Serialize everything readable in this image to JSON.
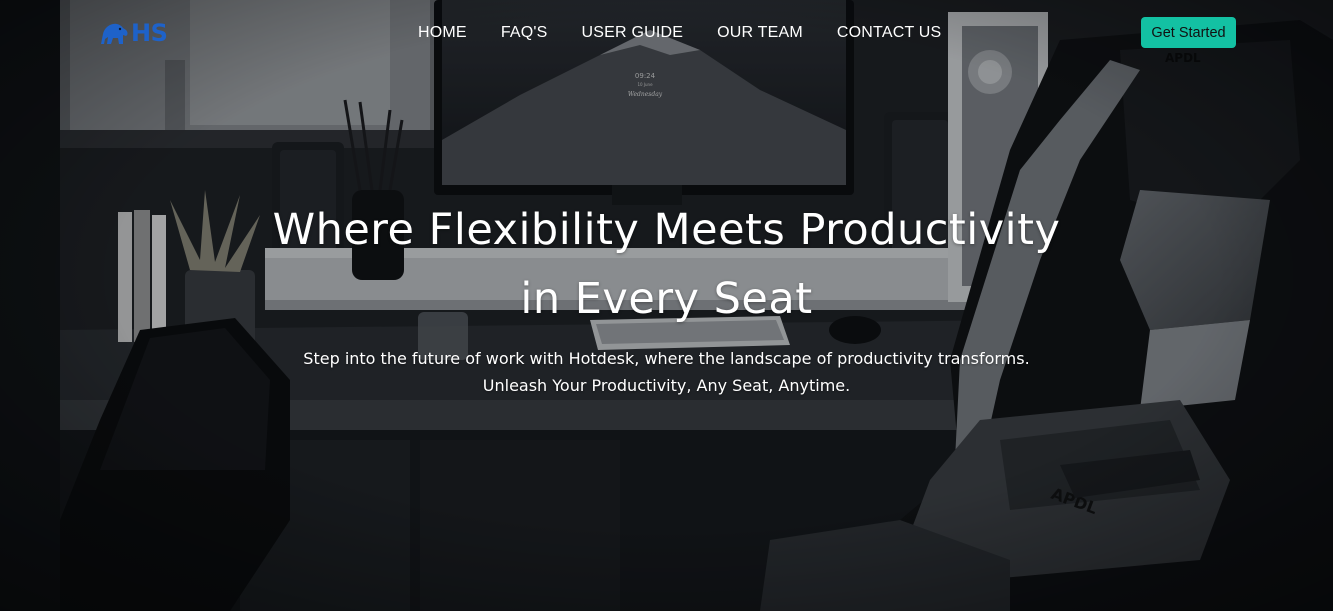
{
  "brand": {
    "logo_text": "HS",
    "logo_icon": "gorilla-icon",
    "logo_color": "#1e62c9"
  },
  "nav": {
    "items": [
      {
        "label": "HOME"
      },
      {
        "label": "FAQ'S"
      },
      {
        "label": "USER GUIDE"
      },
      {
        "label": "OUR TEAM"
      },
      {
        "label": "CONTACT US"
      }
    ]
  },
  "cta": {
    "label": "Get Started",
    "color": "#13c1a3"
  },
  "hero": {
    "headline_line1": "Where Flexibility Meets Productivity",
    "headline_line2": "in Every Seat",
    "subtext_line1": "Step into the future of work with Hotdesk, where the landscape of productivity transforms.",
    "subtext_line2": "Unleash Your Productivity, Any Seat, Anytime.",
    "background_image": "dark-desk-setup-with-gaming-chair",
    "monitor_clock_time": "09:24",
    "monitor_clock_date": "10 June",
    "monitor_clock_day": "Wednesday",
    "chair_brand": "APDL"
  }
}
